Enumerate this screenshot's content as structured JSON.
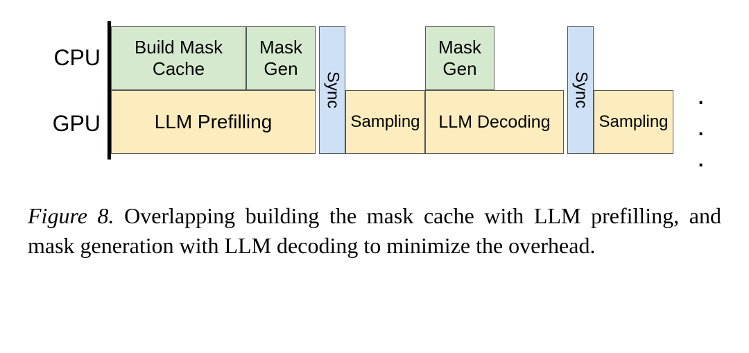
{
  "rows": {
    "cpu": "CPU",
    "gpu": "GPU"
  },
  "blocks": {
    "build_mask_cache": "Build Mask Cache",
    "mask_gen_1": "Mask\nGen",
    "mask_gen_2": "Mask\nGen",
    "llm_prefilling": "LLM Prefilling",
    "sampling_1": "Sampling",
    "llm_decoding": "LLM Decoding",
    "sampling_2": "Sampling",
    "sync_1": "Sync",
    "sync_2": "Sync"
  },
  "ellipsis": ". . .",
  "caption": {
    "fig_label": "Figure 8.",
    "text": " Overlapping building the mask cache with LLM prefilling, and mask generation with LLM decoding to minimize the overhead."
  },
  "chart_data": {
    "type": "timeline",
    "description": "CPU and GPU overlapping pipeline stages with sync barriers",
    "lanes": [
      {
        "name": "CPU",
        "blocks": [
          {
            "label": "Build Mask Cache",
            "start": 0,
            "end": 200
          },
          {
            "label": "Mask Gen",
            "start": 200,
            "end": 300
          },
          {
            "label": "Mask Gen",
            "start": 450,
            "end": 550
          }
        ]
      },
      {
        "name": "GPU",
        "blocks": [
          {
            "label": "LLM Prefilling",
            "start": 0,
            "end": 300
          },
          {
            "label": "Sampling",
            "start": 340,
            "end": 450
          },
          {
            "label": "LLM Decoding",
            "start": 450,
            "end": 650
          },
          {
            "label": "Sampling",
            "start": 690,
            "end": 800
          }
        ]
      }
    ],
    "sync_barriers": [
      310,
      660
    ],
    "continues": true
  }
}
